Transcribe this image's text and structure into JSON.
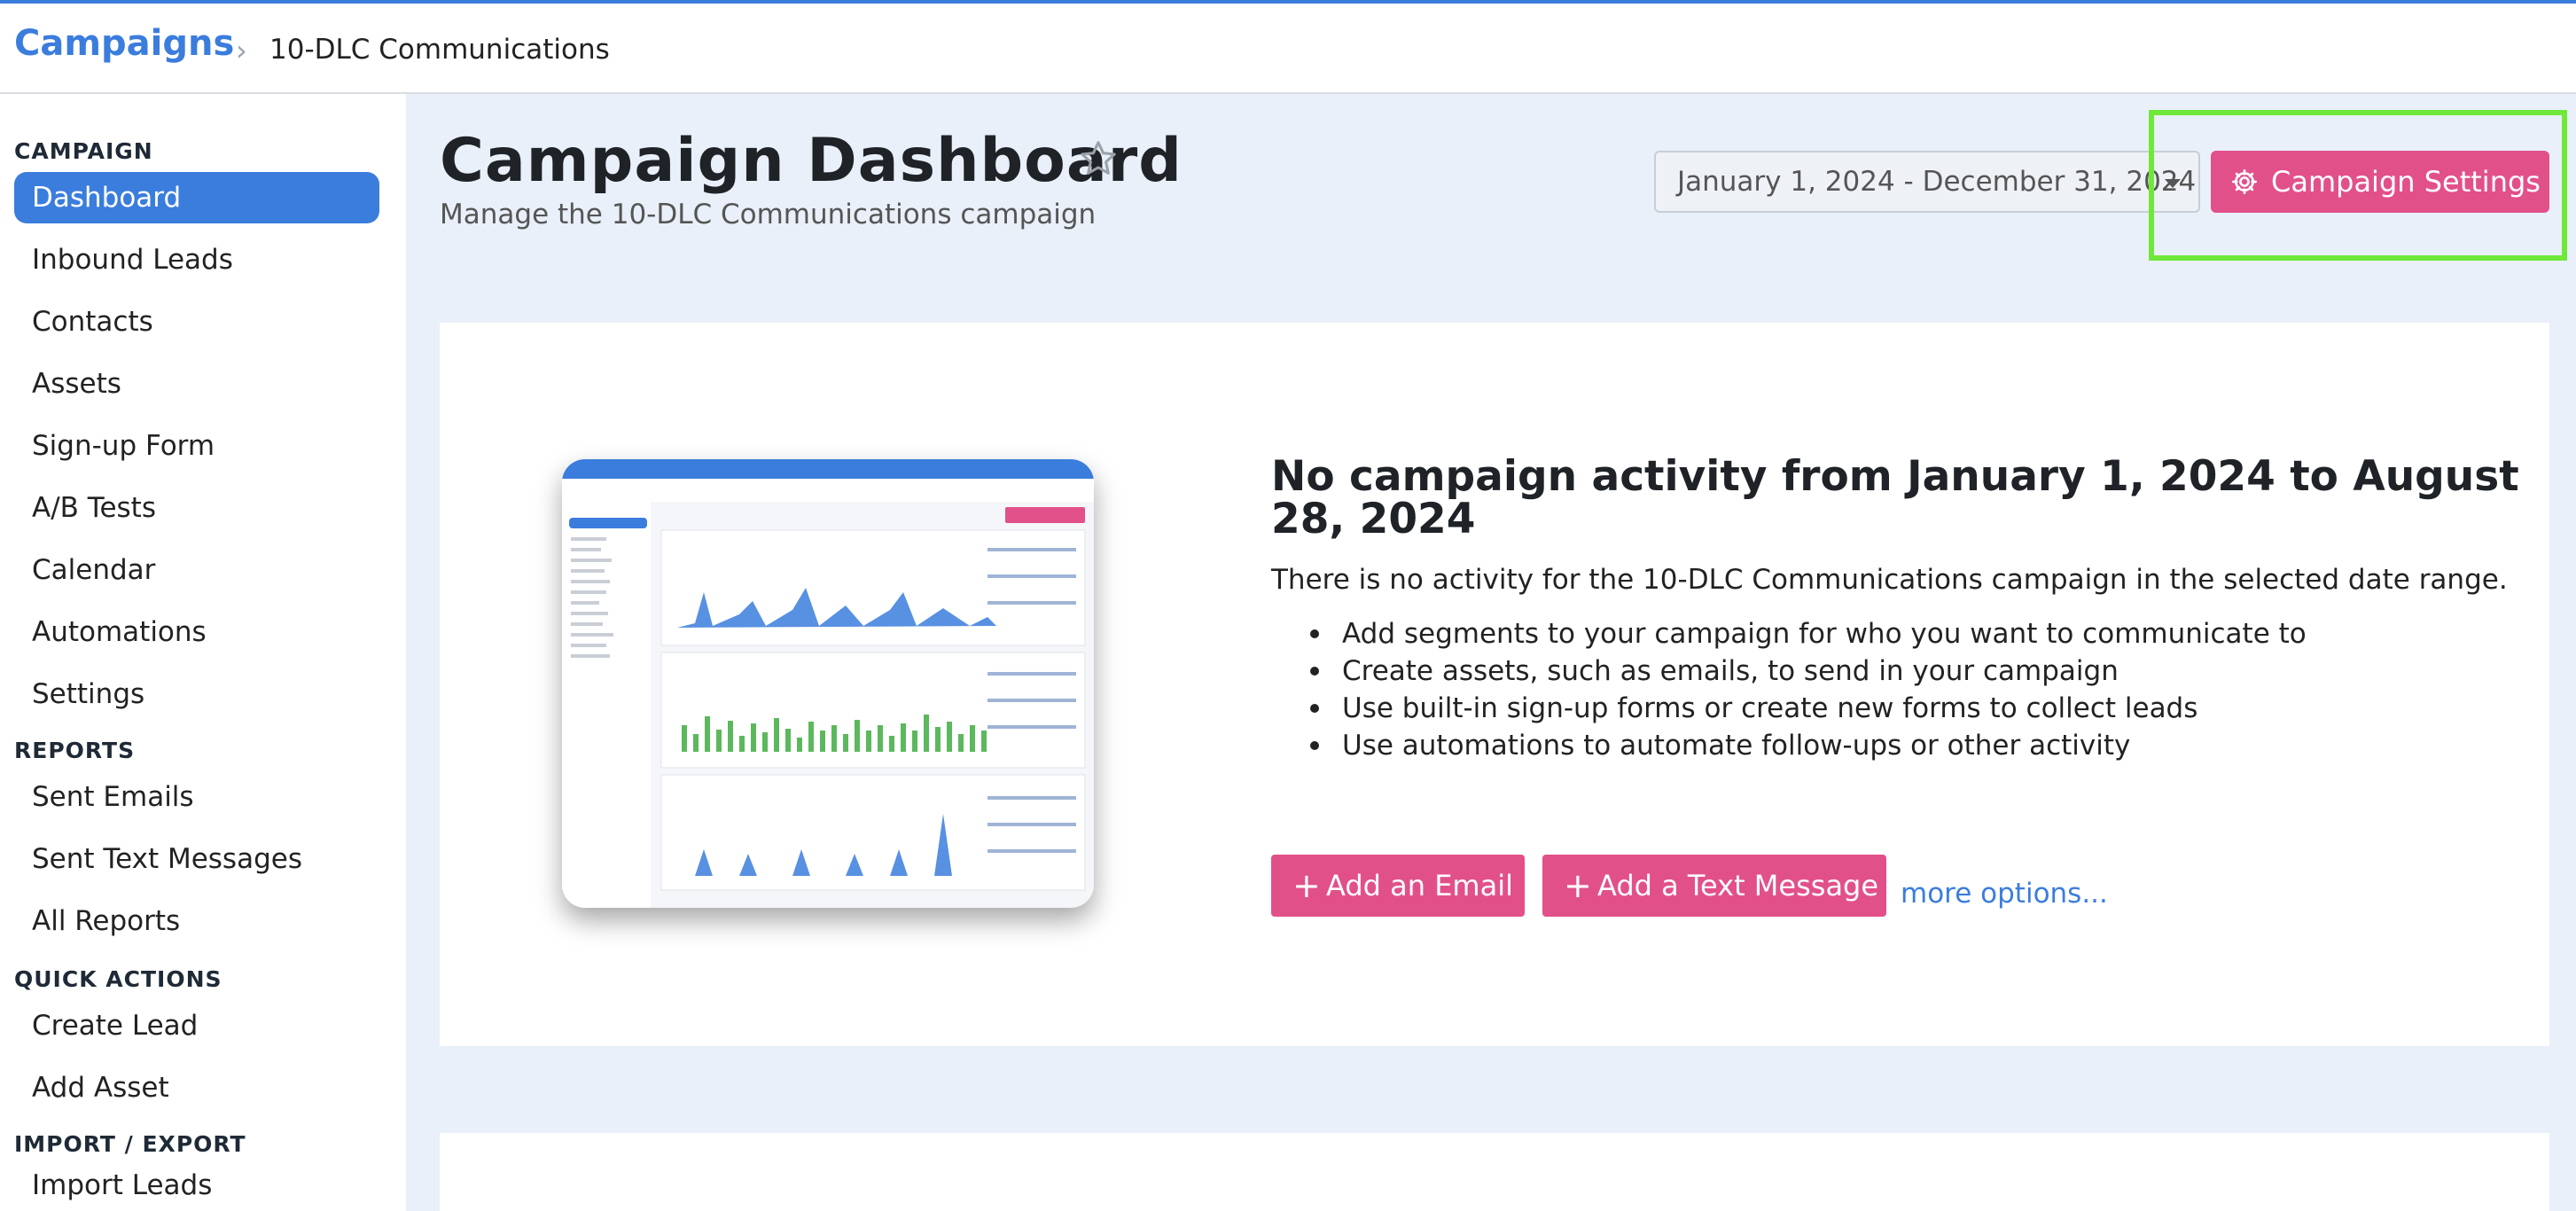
{
  "breadcrumb": {
    "root": "Campaigns",
    "separator": "›",
    "current": "10-DLC Communications"
  },
  "sidebar": {
    "sections": [
      {
        "heading": "CAMPAIGN",
        "items": [
          {
            "label": "Dashboard",
            "active": true
          },
          {
            "label": "Inbound Leads"
          },
          {
            "label": "Contacts"
          },
          {
            "label": "Assets"
          },
          {
            "label": "Sign-up Form"
          },
          {
            "label": "A/B Tests"
          },
          {
            "label": "Calendar"
          },
          {
            "label": "Automations"
          },
          {
            "label": "Settings"
          }
        ]
      },
      {
        "heading": "REPORTS",
        "items": [
          {
            "label": "Sent Emails"
          },
          {
            "label": "Sent Text Messages"
          },
          {
            "label": "All Reports"
          }
        ]
      },
      {
        "heading": "QUICK ACTIONS",
        "items": [
          {
            "label": "Create Lead"
          },
          {
            "label": "Add Asset"
          }
        ]
      },
      {
        "heading": "IMPORT / EXPORT",
        "items": [
          {
            "label": "Import Leads"
          }
        ]
      }
    ]
  },
  "header": {
    "title": "Campaign Dashboard",
    "subtitle": "Manage the 10-DLC Communications campaign",
    "date_range": "January 1, 2024 - December 31, 2024",
    "settings_button": "Campaign Settings"
  },
  "empty_state": {
    "title": "No campaign activity from January 1, 2024 to August 28, 2024",
    "description": "There is no activity for the 10-DLC Communications campaign in the selected date range.",
    "tips": [
      "Add segments to your campaign for who you want to communicate to",
      "Create assets, such as emails, to send in your campaign",
      "Use built-in sign-up forms or create new forms to collect leads",
      "Use automations to automate follow-ups or other activity"
    ],
    "add_email_button": "Add an Email",
    "add_text_button": "Add a Text Message",
    "more_link": "more options..."
  },
  "colors": {
    "accent_blue": "#3b7ddd",
    "pink": "#e2508a",
    "highlight_green": "#6fe83a",
    "main_bg": "#e9f0f9"
  }
}
